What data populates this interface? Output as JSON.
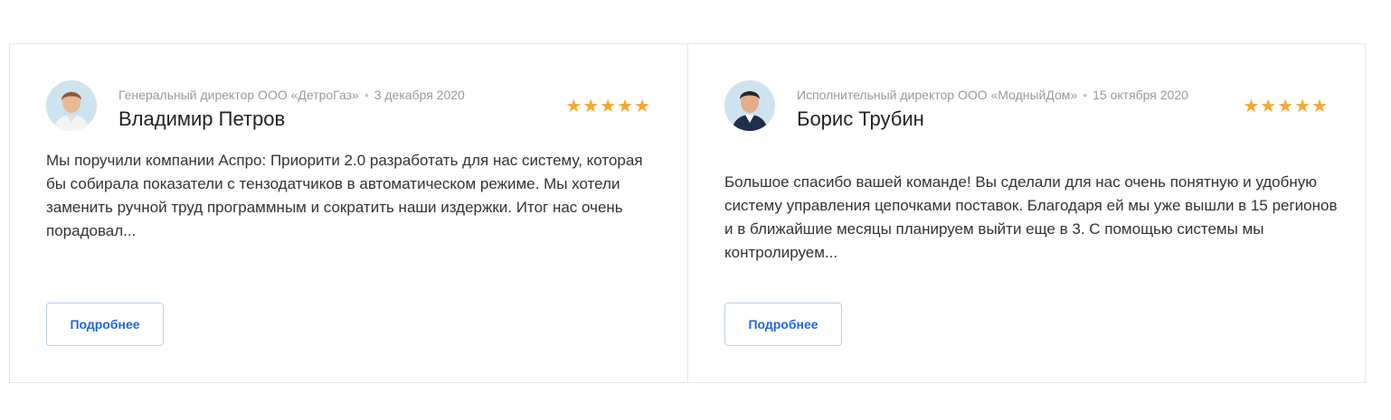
{
  "reviews": [
    {
      "meta_position": "Генеральный директор ООО «ДетроГаз»",
      "meta_separator": "•",
      "date": "3 декабря 2020",
      "name": "Владимир Петров",
      "stars": "★★★★★",
      "rating": 5,
      "text": "Мы поручили компании Аспро: Приорити 2.0 разработать для нас систему, которая бы собирала показатели с тензодатчиков в автоматическом режиме. Мы хотели заменить ручной труд программным и сократить наши издержки. Итог нас очень порадовал...",
      "button_label": "Подробнее"
    },
    {
      "meta_position": "Исполнительный директор ООО «МодныйДом»",
      "meta_separator": "•",
      "date": "15 октября 2020",
      "name": "Борис Трубин",
      "stars": "★★★★★",
      "rating": 5,
      "text": "Большое спасибо вашей команде! Вы сделали для нас очень понятную и удобную систему управления цепочками поставок. Благодаря ей мы уже вышли в 15 регионов и в ближайшие месяцы планируем выйти еще в 3. С помощью системы мы контролируем...",
      "button_label": "Подробнее"
    }
  ],
  "colors": {
    "star": "#f5a733",
    "button_text": "#2266d6",
    "border": "#e6e6e6"
  }
}
